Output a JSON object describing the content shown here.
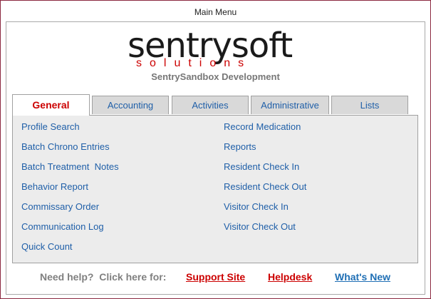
{
  "window": {
    "title": "Main Menu"
  },
  "logo": {
    "main_text": "sentrysoft",
    "sub_text": "solutions"
  },
  "subtitle": "SentrySandbox Development",
  "tabs": [
    {
      "label": "General",
      "active": true
    },
    {
      "label": "Accounting",
      "active": false
    },
    {
      "label": "Activities",
      "active": false
    },
    {
      "label": "Administrative",
      "active": false
    },
    {
      "label": "Lists",
      "active": false
    }
  ],
  "menu": {
    "left": [
      "Profile Search",
      "Batch Chrono Entries",
      "Batch Treatment  Notes",
      "Behavior Report",
      "Commissary Order",
      "Communication Log",
      "Quick Count"
    ],
    "right": [
      "Record Medication",
      "Reports",
      "Resident Check In",
      "Resident Check Out",
      "Visitor Check In",
      "Visitor Check Out"
    ]
  },
  "footer": {
    "help_text": "Need help?  Click here for:",
    "links": [
      {
        "label": "Support Site",
        "color": "#cc0000"
      },
      {
        "label": "Helpdesk",
        "color": "#cc0000"
      },
      {
        "label": "What's New",
        "color": "#1f6fb5"
      }
    ]
  },
  "colors": {
    "accent_red": "#cc0000",
    "link_blue": "#1f5fa8",
    "window_border": "#8b2840",
    "panel_bg": "#ececec"
  }
}
